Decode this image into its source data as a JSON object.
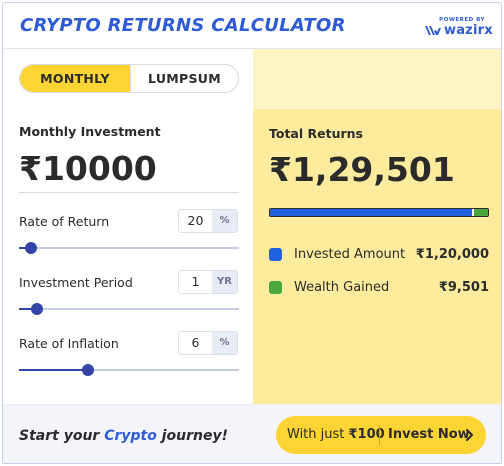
{
  "header": {
    "title": "CRYPTO RETURNS CALCULATOR",
    "powered_by": "POWERED BY",
    "brand": "wazirx"
  },
  "tabs": [
    {
      "label": "MONTHLY",
      "selected": true
    },
    {
      "label": "LUMPSUM",
      "selected": false
    }
  ],
  "investment": {
    "label": "Monthly Investment",
    "value": "₹10000"
  },
  "inputs": {
    "rate_of_return": {
      "label": "Rate of Return",
      "value": "20",
      "unit": "%",
      "slider_fraction": 0.04
    },
    "investment_period": {
      "label": "Investment Period",
      "value": "1",
      "unit": "YR",
      "slider_fraction": 0.07
    },
    "rate_of_inflation": {
      "label": "Rate of Inflation",
      "value": "6",
      "unit": "%",
      "slider_fraction": 0.3
    }
  },
  "results": {
    "total_label": "Total Returns",
    "total_value": "₹1,29,501",
    "invested_fraction": 0.927,
    "legend": [
      {
        "name": "Invested Amount",
        "amount": "₹1,20,000",
        "color": "#2160e0"
      },
      {
        "name": "Wealth Gained",
        "amount": "₹9,501",
        "color": "#49a83c"
      }
    ]
  },
  "footer": {
    "tagline_prefix": "Start your ",
    "tagline_highlight": "Crypto",
    "tagline_suffix": " journey!",
    "cta_prefix": "With just ",
    "cta_amount": "₹100",
    "cta_action": "Invest Now"
  },
  "colors": {
    "accent_blue": "#2f5cd6",
    "accent_yellow": "#fcd535",
    "slider": "#3345a8",
    "panel_light": "#fdf5c4",
    "panel_band": "#fdec9e"
  }
}
